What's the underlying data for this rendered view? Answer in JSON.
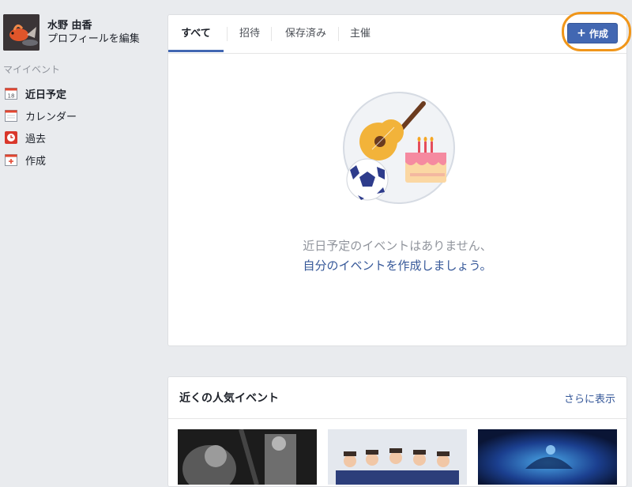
{
  "profile": {
    "name": "水野 由香",
    "edit_label": "プロフィールを編集"
  },
  "sidebar": {
    "section_title": "マイイベント",
    "items": [
      {
        "label": "近日予定",
        "icon": "calendar-day-icon",
        "active": true
      },
      {
        "label": "カレンダー",
        "icon": "calendar-icon",
        "active": false
      },
      {
        "label": "過去",
        "icon": "clock-icon",
        "active": false
      },
      {
        "label": "作成",
        "icon": "add-event-icon",
        "active": false
      }
    ]
  },
  "calendar_icon_day": "18",
  "main": {
    "tabs": [
      {
        "label": "すべて",
        "active": true
      },
      {
        "label": "招待",
        "active": false
      },
      {
        "label": "保存済み",
        "active": false
      },
      {
        "label": "主催",
        "active": false
      }
    ],
    "create_button": {
      "plus": "+",
      "label": "作成"
    },
    "empty_line1": "近日予定のイベントはありません、",
    "empty_line2": "自分のイベントを作成しましょう。"
  },
  "popular": {
    "title": "近くの人気イベント",
    "see_more": "さらに表示"
  },
  "colors": {
    "accent": "#4267b2",
    "link": "#365899",
    "highlight": "#f0961a",
    "background": "#e9ebee"
  }
}
